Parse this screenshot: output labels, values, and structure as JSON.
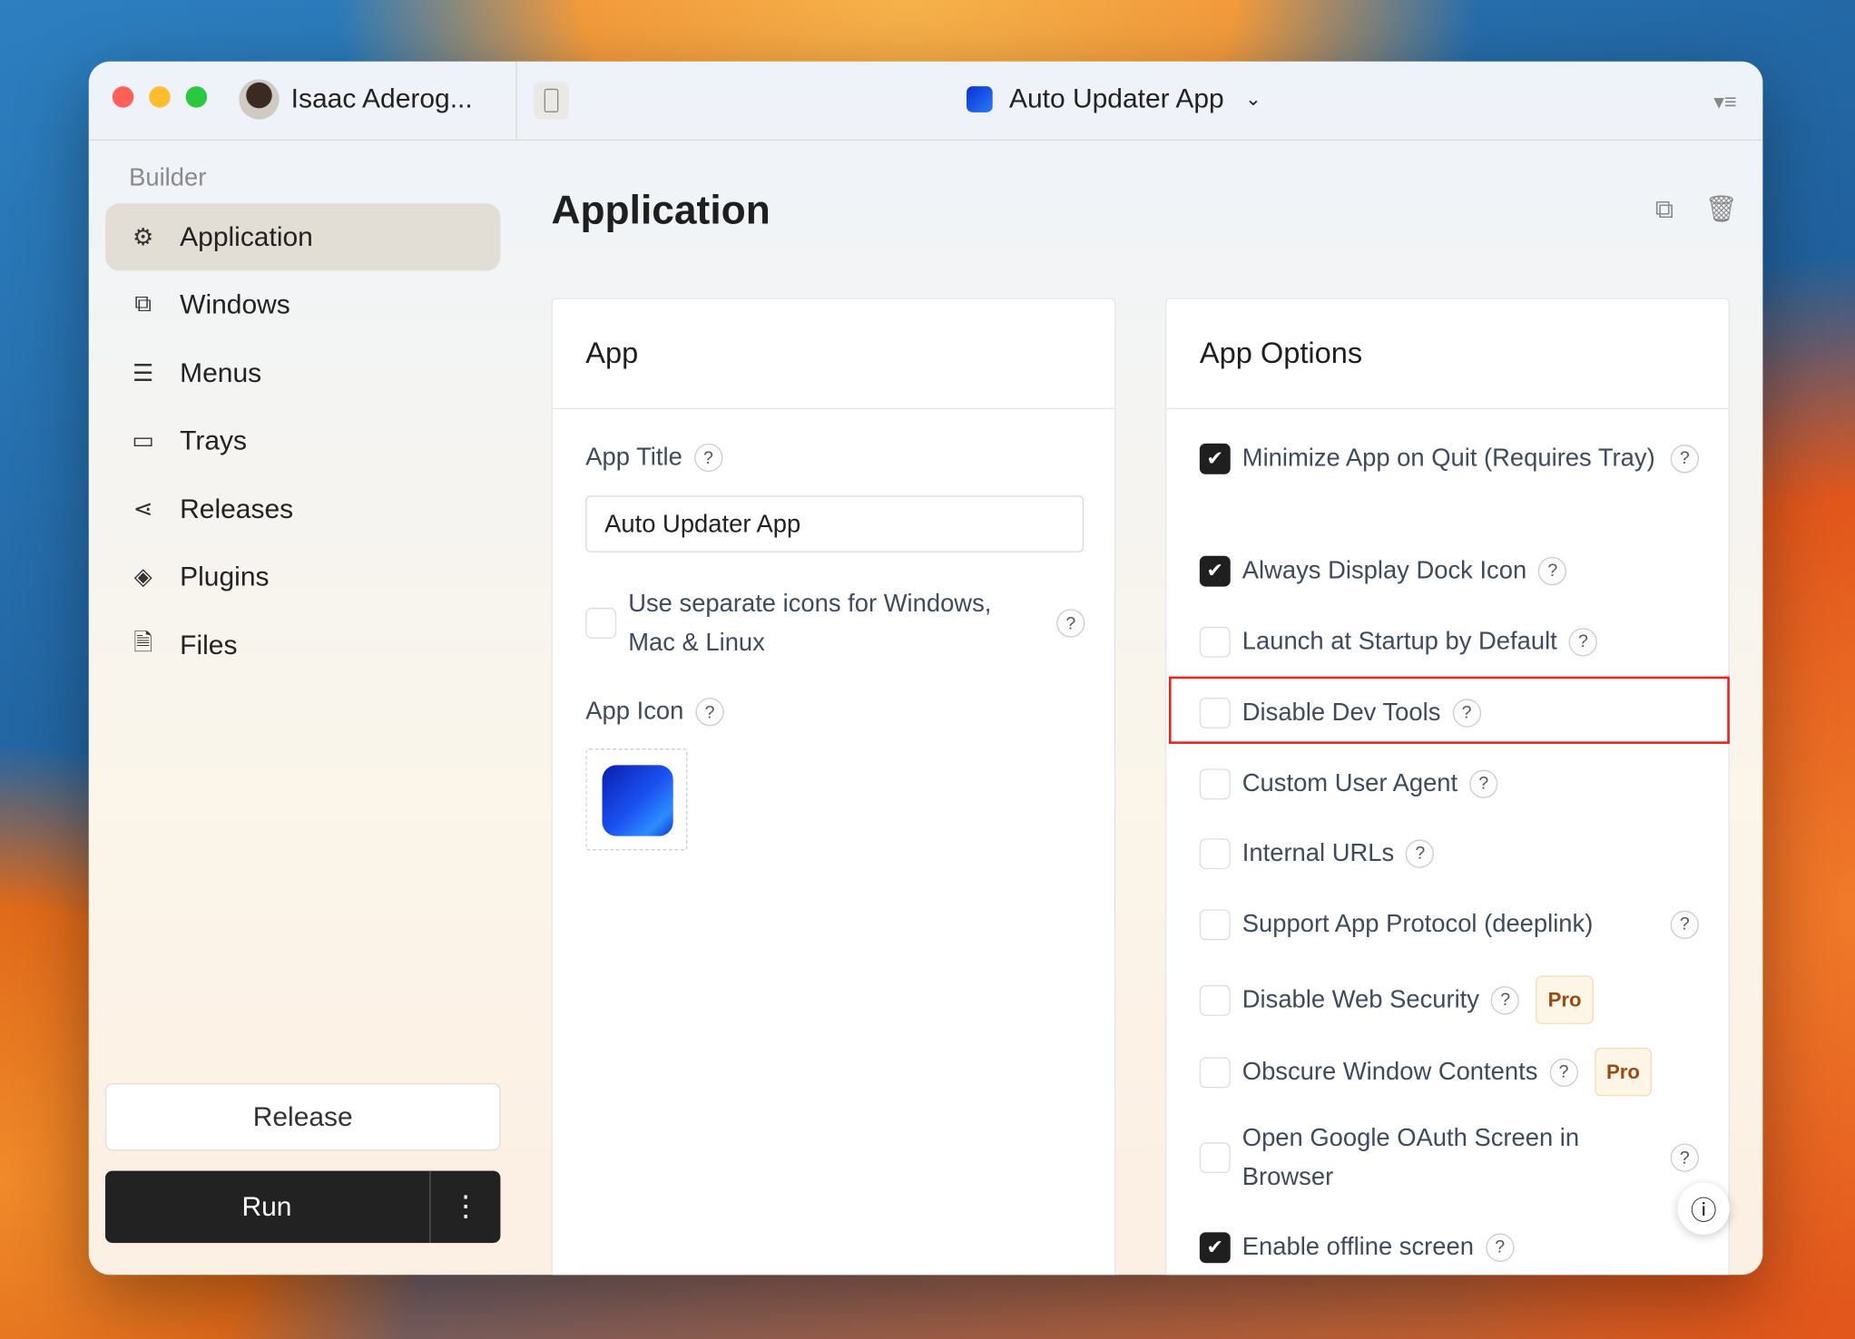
{
  "window": {
    "user_name": "Isaac Aderog...",
    "app_selector": "Auto Updater App"
  },
  "sidebar": {
    "section": "Builder",
    "items": [
      {
        "label": "Application",
        "icon": "gear-icon",
        "active": true
      },
      {
        "label": "Windows",
        "icon": "window-icon"
      },
      {
        "label": "Menus",
        "icon": "menu-icon"
      },
      {
        "label": "Trays",
        "icon": "tray-icon"
      },
      {
        "label": "Releases",
        "icon": "share-icon"
      },
      {
        "label": "Plugins",
        "icon": "layers-icon"
      },
      {
        "label": "Files",
        "icon": "file-icon"
      }
    ],
    "release_label": "Release",
    "run_label": "Run",
    "more_label": "⋮"
  },
  "main": {
    "title": "Application",
    "app_card": {
      "title": "App",
      "app_title_label": "App Title",
      "app_title_value": "Auto Updater App",
      "separate_icons_label": "Use separate icons for Windows, Mac & Linux",
      "separate_icons_checked": false,
      "app_icon_label": "App Icon"
    },
    "options_card": {
      "title": "App Options",
      "options": [
        {
          "label": "Minimize App on Quit (Requires Tray)",
          "checked": true
        },
        {
          "label": "Always Display Dock Icon",
          "checked": true
        },
        {
          "label": "Launch at Startup by Default",
          "checked": false
        },
        {
          "label": "Disable Dev Tools",
          "checked": false,
          "highlighted": true
        },
        {
          "label": "Custom User Agent",
          "checked": false
        },
        {
          "label": "Internal URLs",
          "checked": false
        },
        {
          "label": "Support App Protocol (deeplink)",
          "checked": false
        },
        {
          "label": "Disable Web Security",
          "checked": false,
          "badge": "Pro"
        },
        {
          "label": "Obscure Window Contents",
          "checked": false,
          "badge": "Pro"
        },
        {
          "label": "Open Google OAuth Screen in Browser",
          "checked": false
        },
        {
          "label": "Enable offline screen",
          "checked": true
        }
      ]
    }
  },
  "help_glyph": "?",
  "colors": {
    "highlight": "#e5261f",
    "pro_text": "#9a4a12",
    "checkbox_on": "#1f1f1f"
  }
}
